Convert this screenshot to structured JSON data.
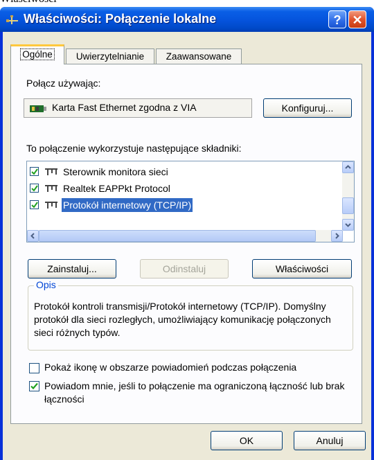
{
  "cropped_header_text": "Właściwości",
  "window": {
    "title": "Właściwości: Połączenie lokalne",
    "help_label": "?",
    "close_label": "✕"
  },
  "tabs": [
    {
      "label": "Ogólne",
      "active": true
    },
    {
      "label": "Uwierzytelnianie",
      "active": false
    },
    {
      "label": "Zaawansowane",
      "active": false
    }
  ],
  "general": {
    "connect_using_label": "Połącz używając:",
    "adapter_name": "Karta Fast Ethernet zgodna z VIA",
    "configure_button": "Konfiguruj...",
    "components_label": "To połączenie wykorzystuje następujące składniki:",
    "components": [
      {
        "label": "Sterownik monitora sieci",
        "checked": true,
        "selected": false
      },
      {
        "label": "Realtek EAPPkt Protocol",
        "checked": true,
        "selected": false
      },
      {
        "label": "Protokół internetowy (TCP/IP)",
        "checked": true,
        "selected": true
      }
    ],
    "install_button": "Zainstaluj...",
    "uninstall_button": "Odinstaluj",
    "properties_button": "Właściwości",
    "description_legend": "Opis",
    "description_text": "Protokół kontroli transmisji/Protokół internetowy (TCP/IP). Domyślny protokół dla sieci rozległych, umożliwiający komunikację połączonych sieci różnych typów.",
    "show_icon_option": {
      "label": "Pokaż ikonę w obszarze powiadomień podczas połączenia",
      "checked": false
    },
    "notify_option": {
      "label": "Powiadom mnie, jeśli to połączenie ma ograniczoną łączność lub brak łączności",
      "checked": true
    }
  },
  "footer": {
    "ok_button": "OK",
    "cancel_button": "Anuluj"
  },
  "colors": {
    "title_bar": "#0553dc",
    "selection": "#316ac5",
    "group_legend": "#0046d5",
    "dialog_face": "#ece9d8"
  }
}
